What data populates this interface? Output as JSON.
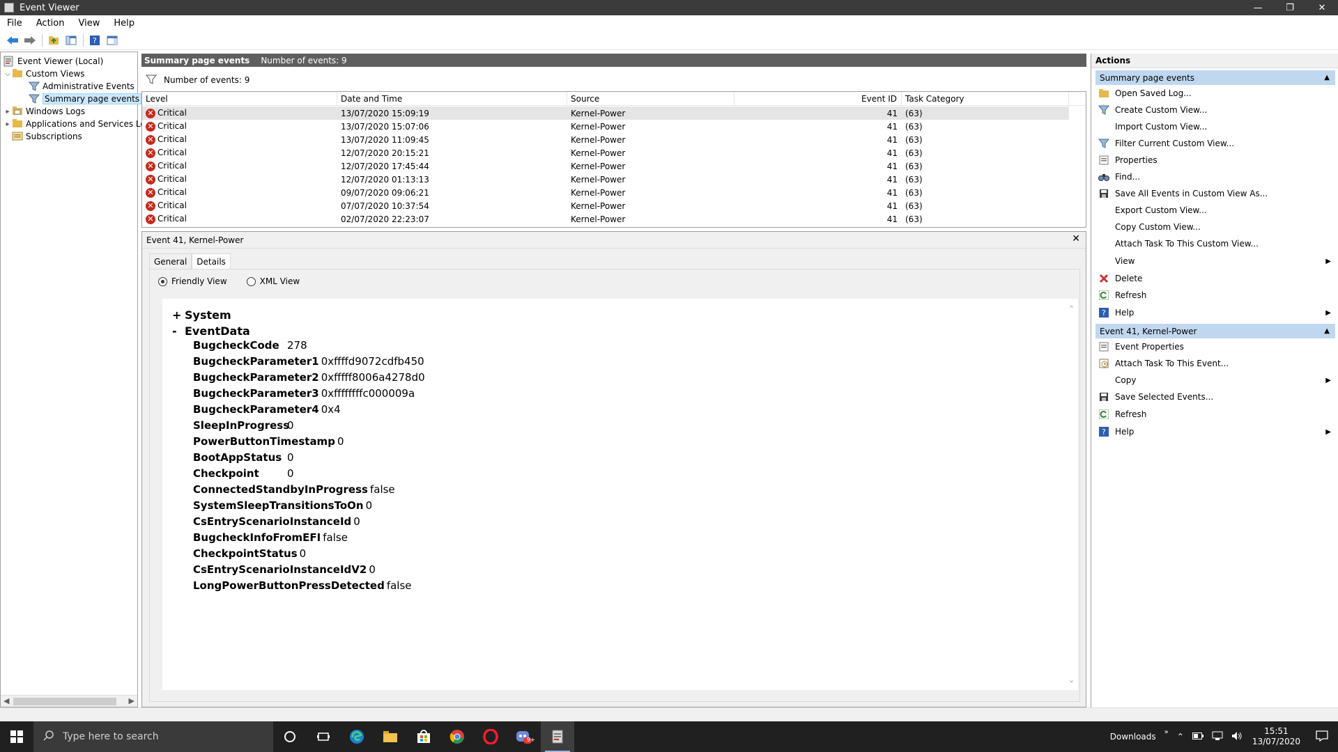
{
  "window": {
    "title": "Event Viewer"
  },
  "menu": [
    "File",
    "Action",
    "View",
    "Help"
  ],
  "tree": {
    "root": "Event Viewer (Local)",
    "custom_views": "Custom Views",
    "administrative_events": "Administrative Events",
    "summary_page_events": "Summary page events",
    "windows_logs": "Windows Logs",
    "applications_services": "Applications and Services Lo",
    "subscriptions": "Subscriptions"
  },
  "center": {
    "header_title": "Summary page events",
    "header_count": "Number of events: 9",
    "filter_text": "Number of events: 9",
    "columns": [
      "Level",
      "Date and Time",
      "Source",
      "Event ID",
      "Task Category"
    ],
    "rows": [
      {
        "level": "Critical",
        "datetime": "13/07/2020 15:09:19",
        "source": "Kernel-Power",
        "event_id": "41",
        "task": "(63)"
      },
      {
        "level": "Critical",
        "datetime": "13/07/2020 15:07:06",
        "source": "Kernel-Power",
        "event_id": "41",
        "task": "(63)"
      },
      {
        "level": "Critical",
        "datetime": "13/07/2020 11:09:45",
        "source": "Kernel-Power",
        "event_id": "41",
        "task": "(63)"
      },
      {
        "level": "Critical",
        "datetime": "12/07/2020 20:15:21",
        "source": "Kernel-Power",
        "event_id": "41",
        "task": "(63)"
      },
      {
        "level": "Critical",
        "datetime": "12/07/2020 17:45:44",
        "source": "Kernel-Power",
        "event_id": "41",
        "task": "(63)"
      },
      {
        "level": "Critical",
        "datetime": "12/07/2020 01:13:13",
        "source": "Kernel-Power",
        "event_id": "41",
        "task": "(63)"
      },
      {
        "level": "Critical",
        "datetime": "09/07/2020 09:06:21",
        "source": "Kernel-Power",
        "event_id": "41",
        "task": "(63)"
      },
      {
        "level": "Critical",
        "datetime": "07/07/2020 10:37:54",
        "source": "Kernel-Power",
        "event_id": "41",
        "task": "(63)"
      },
      {
        "level": "Critical",
        "datetime": "02/07/2020 22:23:07",
        "source": "Kernel-Power",
        "event_id": "41",
        "task": "(63)"
      }
    ]
  },
  "details": {
    "title": "Event 41, Kernel-Power",
    "tabs": [
      "General",
      "Details"
    ],
    "radio_friendly": "Friendly View",
    "radio_xml": "XML View",
    "system_label": "System",
    "system_toggle": "+",
    "eventdata_label": "EventData",
    "eventdata_toggle": "-",
    "fields": [
      {
        "k": "BugcheckCode",
        "v": "278"
      },
      {
        "k": "BugcheckParameter1",
        "v": "0xffffd9072cdfb450"
      },
      {
        "k": "BugcheckParameter2",
        "v": "0xfffff8006a4278d0"
      },
      {
        "k": "BugcheckParameter3",
        "v": "0xffffffffc000009a"
      },
      {
        "k": "BugcheckParameter4",
        "v": "0x4"
      },
      {
        "k": "SleepInProgress",
        "v": "0"
      },
      {
        "k": "PowerButtonTimestamp",
        "v": "0"
      },
      {
        "k": "BootAppStatus",
        "v": "0"
      },
      {
        "k": "Checkpoint",
        "v": "0"
      },
      {
        "k": "ConnectedStandbyInProgress",
        "v": "false"
      },
      {
        "k": "SystemSleepTransitionsToOn",
        "v": "0"
      },
      {
        "k": "CsEntryScenarioInstanceId",
        "v": "0"
      },
      {
        "k": "BugcheckInfoFromEFI",
        "v": "false"
      },
      {
        "k": "CheckpointStatus",
        "v": "0"
      },
      {
        "k": "CsEntryScenarioInstanceIdV2",
        "v": "0"
      },
      {
        "k": "LongPowerButtonPressDetected",
        "v": "false"
      }
    ]
  },
  "actions": {
    "title": "Actions",
    "section1": "Summary page events",
    "items1": [
      "Open Saved Log...",
      "Create Custom View...",
      "Import Custom View...",
      "Filter Current Custom View...",
      "Properties",
      "Find...",
      "Save All Events in Custom View As...",
      "Export Custom View...",
      "Copy Custom View...",
      "Attach Task To This Custom View...",
      "View",
      "Delete",
      "Refresh",
      "Help"
    ],
    "section2": "Event 41, Kernel-Power",
    "items2": [
      "Event Properties",
      "Attach Task To This Event...",
      "Copy",
      "Save Selected Events...",
      "Refresh",
      "Help"
    ]
  },
  "taskbar": {
    "search_placeholder": "Type here to search",
    "downloads": "Downloads",
    "time": "15:51",
    "date": "13/07/2020",
    "discord_badge": "9+"
  }
}
